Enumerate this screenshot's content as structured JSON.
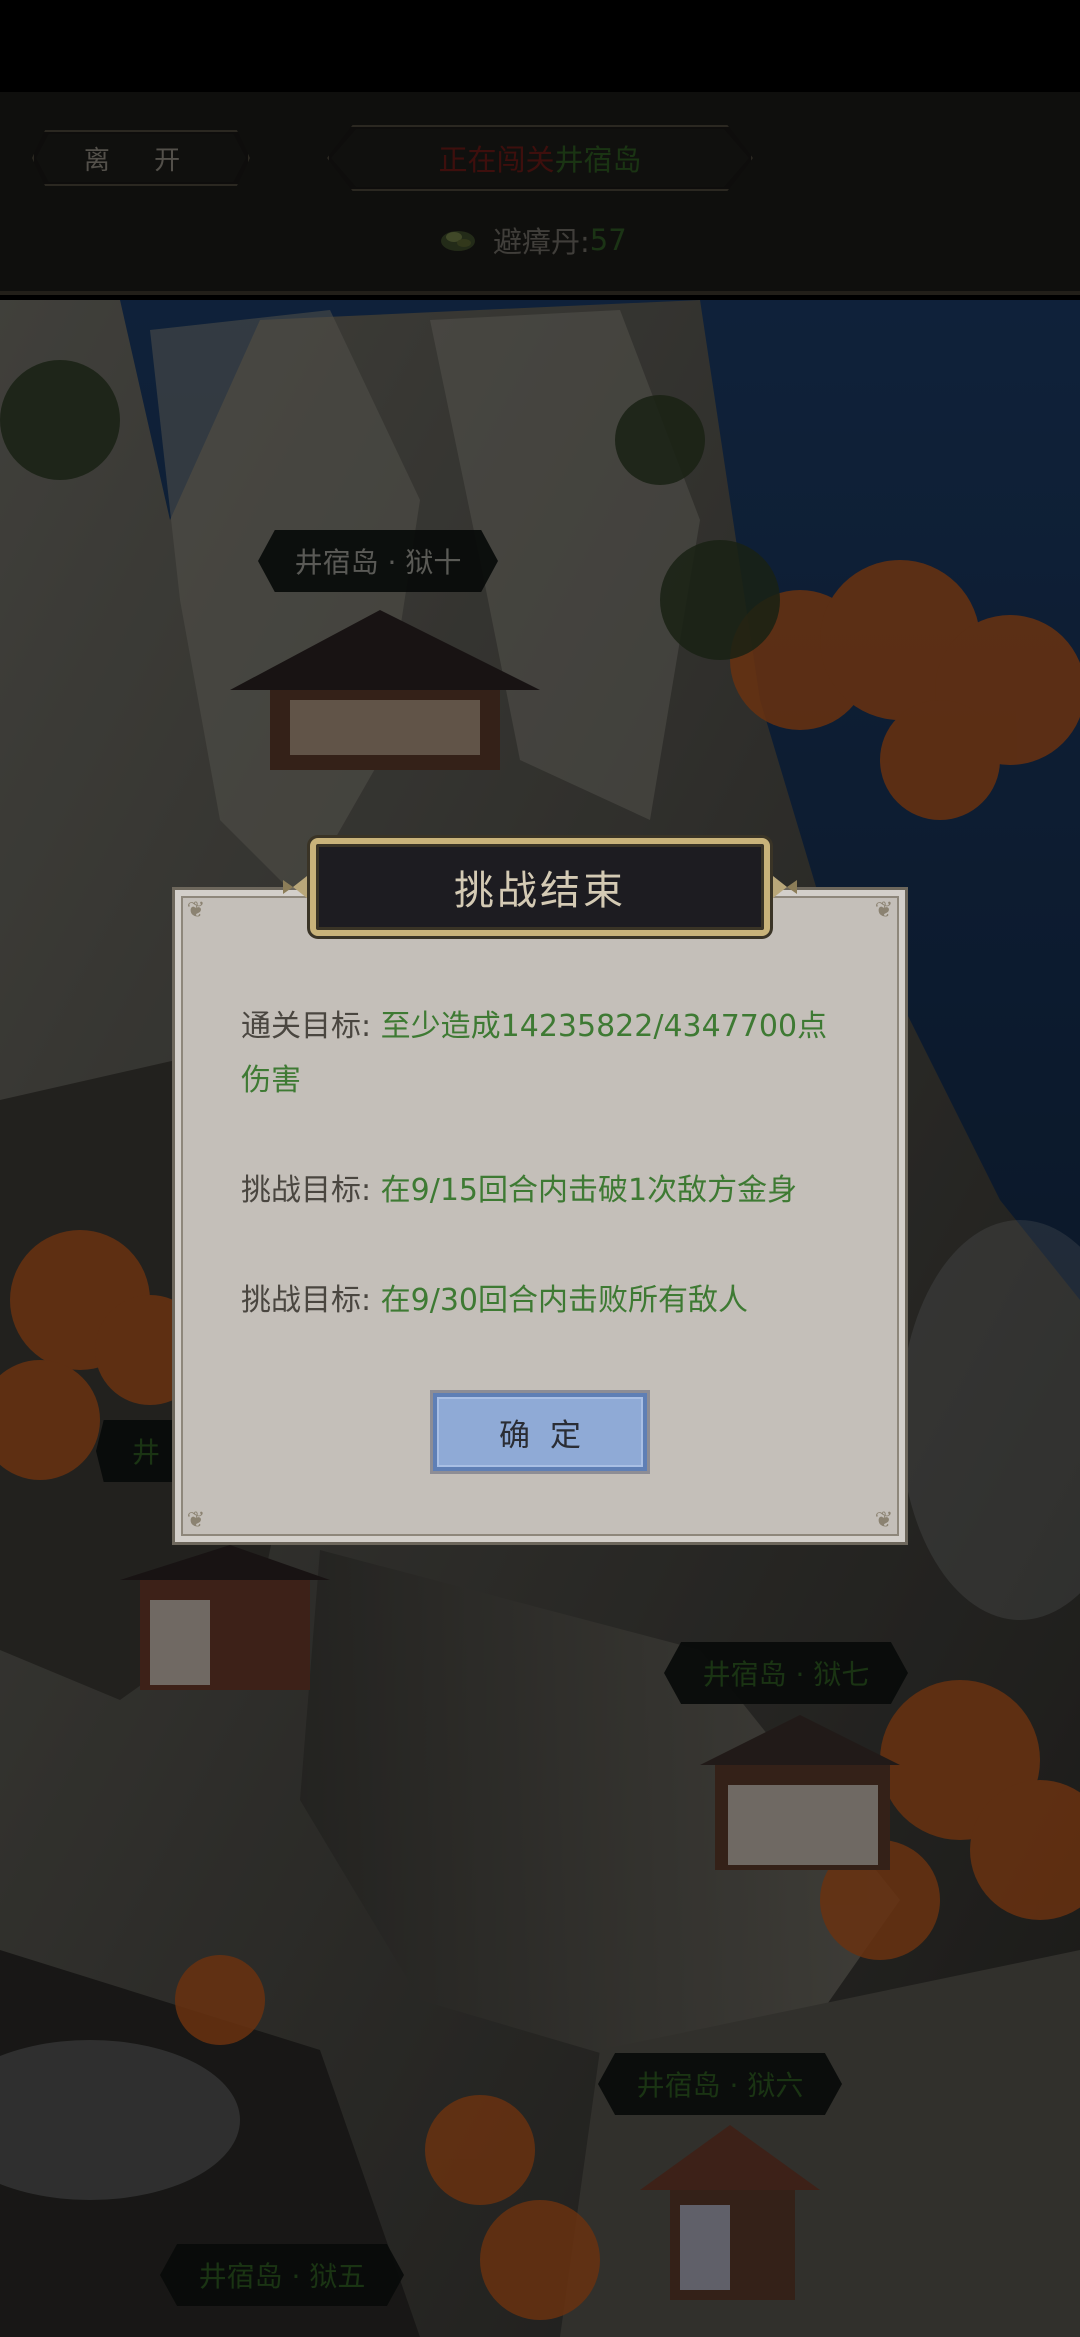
{
  "colors": {
    "accent_gold": "#c9b37a",
    "value_green": "#3e7a33",
    "warn_red": "#6b1a17",
    "button_blue": "#8faad6"
  },
  "header": {
    "leave_label": "离 开",
    "status_prefix": "正在闯关",
    "location": "井宿岛",
    "currency_label": "避瘴丹:",
    "currency_value": "57",
    "currency_icon": "pill-icon"
  },
  "map": {
    "nodes": [
      {
        "id": "jail-10",
        "label": "井宿岛 · 狱十"
      },
      {
        "id": "jail-9",
        "label": "井"
      },
      {
        "id": "jail-7",
        "label": "井宿岛 · 狱七"
      },
      {
        "id": "jail-6",
        "label": "井宿岛 · 狱六"
      },
      {
        "id": "jail-5",
        "label": "井宿岛 · 狱五"
      }
    ]
  },
  "dialog": {
    "title": "挑战结束",
    "goals": [
      {
        "label": "通关目标:",
        "text": "至少造成14235822/4347700点",
        "text2": "伤害"
      },
      {
        "label": "挑战目标:",
        "text": "在9/15回合内击破1次敌方金身"
      },
      {
        "label": "挑战目标:",
        "text": "在9/30回合内击败所有敌人"
      }
    ],
    "confirm_label": "确定"
  }
}
